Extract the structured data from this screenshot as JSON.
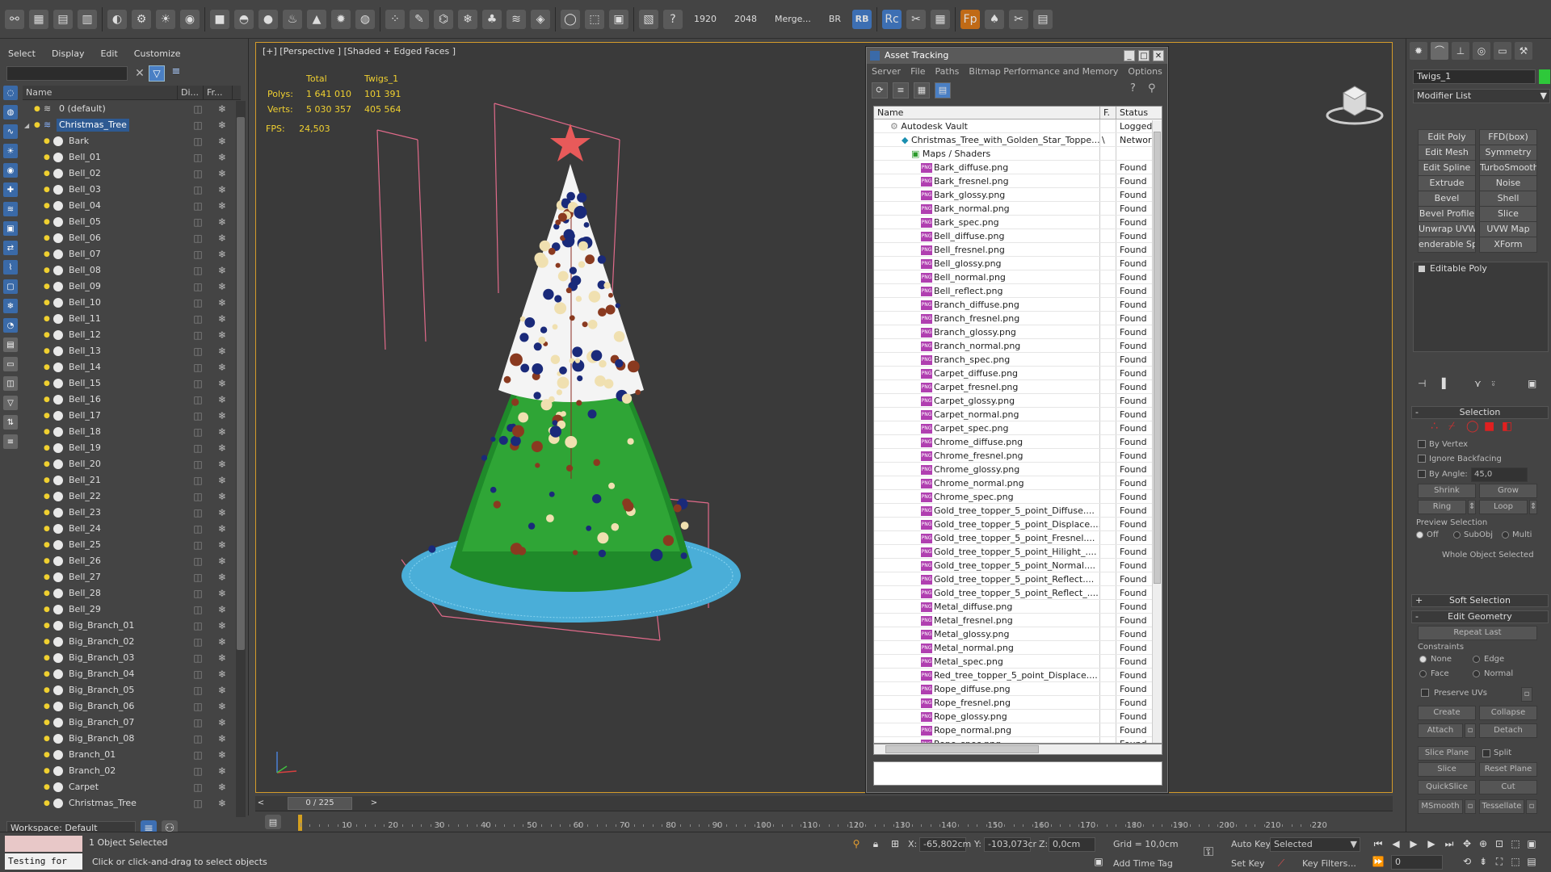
{
  "toolbar": {
    "render_width": "1920",
    "render_height": "2048",
    "merge_label": "Merge...",
    "br_label": "BR",
    "rb_label": "RB"
  },
  "scene_explorer": {
    "menu": [
      "Select",
      "Display",
      "Edit",
      "Customize"
    ],
    "columns": {
      "name": "Name",
      "display": "Di...",
      "freeze": "Fr..."
    },
    "rows": [
      {
        "name": "0 (default)",
        "type": "layer",
        "indent": 0
      },
      {
        "name": "Christmas_Tree",
        "type": "layer",
        "indent": 1,
        "selected": true
      },
      {
        "name": "Bark",
        "type": "obj",
        "indent": 2
      },
      {
        "name": "Bell_01",
        "type": "obj",
        "indent": 2
      },
      {
        "name": "Bell_02",
        "type": "obj",
        "indent": 2
      },
      {
        "name": "Bell_03",
        "type": "obj",
        "indent": 2
      },
      {
        "name": "Bell_04",
        "type": "obj",
        "indent": 2
      },
      {
        "name": "Bell_05",
        "type": "obj",
        "indent": 2
      },
      {
        "name": "Bell_06",
        "type": "obj",
        "indent": 2
      },
      {
        "name": "Bell_07",
        "type": "obj",
        "indent": 2
      },
      {
        "name": "Bell_08",
        "type": "obj",
        "indent": 2
      },
      {
        "name": "Bell_09",
        "type": "obj",
        "indent": 2
      },
      {
        "name": "Bell_10",
        "type": "obj",
        "indent": 2
      },
      {
        "name": "Bell_11",
        "type": "obj",
        "indent": 2
      },
      {
        "name": "Bell_12",
        "type": "obj",
        "indent": 2
      },
      {
        "name": "Bell_13",
        "type": "obj",
        "indent": 2
      },
      {
        "name": "Bell_14",
        "type": "obj",
        "indent": 2
      },
      {
        "name": "Bell_15",
        "type": "obj",
        "indent": 2
      },
      {
        "name": "Bell_16",
        "type": "obj",
        "indent": 2
      },
      {
        "name": "Bell_17",
        "type": "obj",
        "indent": 2
      },
      {
        "name": "Bell_18",
        "type": "obj",
        "indent": 2
      },
      {
        "name": "Bell_19",
        "type": "obj",
        "indent": 2
      },
      {
        "name": "Bell_20",
        "type": "obj",
        "indent": 2
      },
      {
        "name": "Bell_21",
        "type": "obj",
        "indent": 2
      },
      {
        "name": "Bell_22",
        "type": "obj",
        "indent": 2
      },
      {
        "name": "Bell_23",
        "type": "obj",
        "indent": 2
      },
      {
        "name": "Bell_24",
        "type": "obj",
        "indent": 2
      },
      {
        "name": "Bell_25",
        "type": "obj",
        "indent": 2
      },
      {
        "name": "Bell_26",
        "type": "obj",
        "indent": 2
      },
      {
        "name": "Bell_27",
        "type": "obj",
        "indent": 2
      },
      {
        "name": "Bell_28",
        "type": "obj",
        "indent": 2
      },
      {
        "name": "Bell_29",
        "type": "obj",
        "indent": 2
      },
      {
        "name": "Big_Branch_01",
        "type": "obj",
        "indent": 2
      },
      {
        "name": "Big_Branch_02",
        "type": "obj",
        "indent": 2
      },
      {
        "name": "Big_Branch_03",
        "type": "obj",
        "indent": 2
      },
      {
        "name": "Big_Branch_04",
        "type": "obj",
        "indent": 2
      },
      {
        "name": "Big_Branch_05",
        "type": "obj",
        "indent": 2
      },
      {
        "name": "Big_Branch_06",
        "type": "obj",
        "indent": 2
      },
      {
        "name": "Big_Branch_07",
        "type": "obj",
        "indent": 2
      },
      {
        "name": "Big_Branch_08",
        "type": "obj",
        "indent": 2
      },
      {
        "name": "Branch_01",
        "type": "obj",
        "indent": 2
      },
      {
        "name": "Branch_02",
        "type": "obj",
        "indent": 2
      },
      {
        "name": "Carpet",
        "type": "obj",
        "indent": 2
      },
      {
        "name": "Christmas_Tree",
        "type": "obj",
        "indent": 2
      }
    ],
    "workspace": "Workspace: Default"
  },
  "viewport": {
    "label": "[+] [Perspective ] [Shaded + Edged Faces ]",
    "stats_header": {
      "total": "Total",
      "object": "Twigs_1"
    },
    "polys_label": "Polys:",
    "polys_total": "1 641 010",
    "polys_obj": "101 391",
    "verts_label": "Verts:",
    "verts_total": "5 030 357",
    "verts_obj": "405 564",
    "fps_label": "FPS:",
    "fps_value": "24,503"
  },
  "asset_tracking": {
    "title": "Asset Tracking",
    "menu": [
      "Server",
      "File",
      "Paths",
      "Bitmap Performance and Memory",
      "Options"
    ],
    "columns": {
      "name": "Name",
      "f": "F.",
      "status": "Status"
    },
    "vault": {
      "name": "Autodesk Vault",
      "status": "Logged O"
    },
    "scene_file": {
      "name": "Christmas_Tree_with_Golden_Star_Toppe...",
      "f": "\\",
      "status": "Network"
    },
    "maps_folder": "Maps / Shaders",
    "files": [
      "Bark_diffuse.png",
      "Bark_fresnel.png",
      "Bark_glossy.png",
      "Bark_normal.png",
      "Bark_spec.png",
      "Bell_diffuse.png",
      "Bell_fresnel.png",
      "Bell_glossy.png",
      "Bell_normal.png",
      "Bell_reflect.png",
      "Branch_diffuse.png",
      "Branch_fresnel.png",
      "Branch_glossy.png",
      "Branch_normal.png",
      "Branch_spec.png",
      "Carpet_diffuse.png",
      "Carpet_fresnel.png",
      "Carpet_glossy.png",
      "Carpet_normal.png",
      "Carpet_spec.png",
      "Chrome_diffuse.png",
      "Chrome_fresnel.png",
      "Chrome_glossy.png",
      "Chrome_normal.png",
      "Chrome_spec.png",
      "Gold_tree_topper_5_point_Diffuse....",
      "Gold_tree_topper_5_point_Displace....",
      "Gold_tree_topper_5_point_Fresnel....",
      "Gold_tree_topper_5_point_Hilight_....",
      "Gold_tree_topper_5_point_Normal....",
      "Gold_tree_topper_5_point_Reflect....",
      "Gold_tree_topper_5_point_Reflect_....",
      "Metal_diffuse.png",
      "Metal_fresnel.png",
      "Metal_glossy.png",
      "Metal_normal.png",
      "Metal_spec.png",
      "Red_tree_topper_5_point_Displace....",
      "Rope_diffuse.png",
      "Rope_fresnel.png",
      "Rope_glossy.png",
      "Rope_normal.png",
      "Rope_spec.png"
    ],
    "found_label": "Found",
    "png_badge": "PNG"
  },
  "command_panel": {
    "object_name": "Twigs_1",
    "object_color": "#2ec83a",
    "modifier_list": "Modifier List",
    "modifier_buttons": [
      "Edit Poly",
      "FFD(box)",
      "Edit Mesh",
      "Symmetry",
      "Edit Spline",
      "TurboSmooth",
      "Extrude",
      "Noise",
      "Bevel",
      "Shell",
      "Bevel Profile",
      "Slice",
      "Unwrap UVW",
      "UVW Map",
      "enderable Splir",
      "XForm"
    ],
    "stack_item": "Editable Poly",
    "selection": {
      "title": "Selection",
      "by_vertex": "By Vertex",
      "ignore_backfacing": "Ignore Backfacing",
      "by_angle": "By Angle:",
      "angle_value": "45,0",
      "shrink": "Shrink",
      "grow": "Grow",
      "ring": "Ring",
      "loop": "Loop",
      "preview_selection": "Preview Selection",
      "off": "Off",
      "subobj": "SubObj",
      "multi": "Multi",
      "whole_object": "Whole Object Selected"
    },
    "soft_selection": "Soft Selection",
    "edit_geometry": {
      "title": "Edit Geometry",
      "repeat_last": "Repeat Last",
      "constraints": "Constraints",
      "none": "None",
      "edge": "Edge",
      "face": "Face",
      "normal": "Normal",
      "preserve_uvs": "Preserve UVs",
      "create": "Create",
      "collapse": "Collapse",
      "attach": "Attach",
      "detach": "Detach",
      "slice_plane": "Slice Plane",
      "split": "Split",
      "slice": "Slice",
      "reset_plane": "Reset Plane",
      "quickslice": "QuickSlice",
      "cut": "Cut",
      "msmooth": "MSmooth",
      "tessellate": "Tessellate"
    }
  },
  "timeline": {
    "frame_label": "0 / 225",
    "ticks": [
      "10",
      "20",
      "30",
      "40",
      "50",
      "60",
      "70",
      "80",
      "90",
      "100",
      "110",
      "120",
      "130",
      "140",
      "150",
      "160",
      "170",
      "180",
      "190",
      "200",
      "210",
      "220"
    ]
  },
  "status_bar": {
    "maxscript_text": "Testing for",
    "selected_count": "1 Object Selected",
    "prompt": "Click or click-and-drag to select objects",
    "x_label": "X:",
    "x_value": "-65,802cm",
    "y_label": "Y:",
    "y_value": "-103,073cr",
    "z_label": "Z:",
    "z_value": "0,0cm",
    "grid": "Grid = 10,0cm",
    "add_time_tag": "Add Time Tag",
    "auto_key": "Auto Key",
    "selected_dropdown": "Selected",
    "set_key": "Set Key",
    "key_filters": "Key Filters...",
    "frame_value": "0"
  }
}
